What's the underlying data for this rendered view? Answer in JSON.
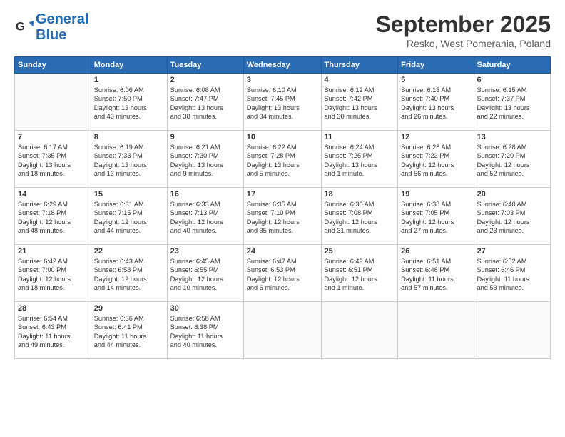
{
  "header": {
    "logo_line1": "General",
    "logo_line2": "Blue",
    "month": "September 2025",
    "location": "Resko, West Pomerania, Poland"
  },
  "weekdays": [
    "Sunday",
    "Monday",
    "Tuesday",
    "Wednesday",
    "Thursday",
    "Friday",
    "Saturday"
  ],
  "weeks": [
    [
      {
        "day": "",
        "info": ""
      },
      {
        "day": "1",
        "info": "Sunrise: 6:06 AM\nSunset: 7:50 PM\nDaylight: 13 hours\nand 43 minutes."
      },
      {
        "day": "2",
        "info": "Sunrise: 6:08 AM\nSunset: 7:47 PM\nDaylight: 13 hours\nand 38 minutes."
      },
      {
        "day": "3",
        "info": "Sunrise: 6:10 AM\nSunset: 7:45 PM\nDaylight: 13 hours\nand 34 minutes."
      },
      {
        "day": "4",
        "info": "Sunrise: 6:12 AM\nSunset: 7:42 PM\nDaylight: 13 hours\nand 30 minutes."
      },
      {
        "day": "5",
        "info": "Sunrise: 6:13 AM\nSunset: 7:40 PM\nDaylight: 13 hours\nand 26 minutes."
      },
      {
        "day": "6",
        "info": "Sunrise: 6:15 AM\nSunset: 7:37 PM\nDaylight: 13 hours\nand 22 minutes."
      }
    ],
    [
      {
        "day": "7",
        "info": "Sunrise: 6:17 AM\nSunset: 7:35 PM\nDaylight: 13 hours\nand 18 minutes."
      },
      {
        "day": "8",
        "info": "Sunrise: 6:19 AM\nSunset: 7:33 PM\nDaylight: 13 hours\nand 13 minutes."
      },
      {
        "day": "9",
        "info": "Sunrise: 6:21 AM\nSunset: 7:30 PM\nDaylight: 13 hours\nand 9 minutes."
      },
      {
        "day": "10",
        "info": "Sunrise: 6:22 AM\nSunset: 7:28 PM\nDaylight: 13 hours\nand 5 minutes."
      },
      {
        "day": "11",
        "info": "Sunrise: 6:24 AM\nSunset: 7:25 PM\nDaylight: 13 hours\nand 1 minute."
      },
      {
        "day": "12",
        "info": "Sunrise: 6:26 AM\nSunset: 7:23 PM\nDaylight: 12 hours\nand 56 minutes."
      },
      {
        "day": "13",
        "info": "Sunrise: 6:28 AM\nSunset: 7:20 PM\nDaylight: 12 hours\nand 52 minutes."
      }
    ],
    [
      {
        "day": "14",
        "info": "Sunrise: 6:29 AM\nSunset: 7:18 PM\nDaylight: 12 hours\nand 48 minutes."
      },
      {
        "day": "15",
        "info": "Sunrise: 6:31 AM\nSunset: 7:15 PM\nDaylight: 12 hours\nand 44 minutes."
      },
      {
        "day": "16",
        "info": "Sunrise: 6:33 AM\nSunset: 7:13 PM\nDaylight: 12 hours\nand 40 minutes."
      },
      {
        "day": "17",
        "info": "Sunrise: 6:35 AM\nSunset: 7:10 PM\nDaylight: 12 hours\nand 35 minutes."
      },
      {
        "day": "18",
        "info": "Sunrise: 6:36 AM\nSunset: 7:08 PM\nDaylight: 12 hours\nand 31 minutes."
      },
      {
        "day": "19",
        "info": "Sunrise: 6:38 AM\nSunset: 7:05 PM\nDaylight: 12 hours\nand 27 minutes."
      },
      {
        "day": "20",
        "info": "Sunrise: 6:40 AM\nSunset: 7:03 PM\nDaylight: 12 hours\nand 23 minutes."
      }
    ],
    [
      {
        "day": "21",
        "info": "Sunrise: 6:42 AM\nSunset: 7:00 PM\nDaylight: 12 hours\nand 18 minutes."
      },
      {
        "day": "22",
        "info": "Sunrise: 6:43 AM\nSunset: 6:58 PM\nDaylight: 12 hours\nand 14 minutes."
      },
      {
        "day": "23",
        "info": "Sunrise: 6:45 AM\nSunset: 6:55 PM\nDaylight: 12 hours\nand 10 minutes."
      },
      {
        "day": "24",
        "info": "Sunrise: 6:47 AM\nSunset: 6:53 PM\nDaylight: 12 hours\nand 6 minutes."
      },
      {
        "day": "25",
        "info": "Sunrise: 6:49 AM\nSunset: 6:51 PM\nDaylight: 12 hours\nand 1 minute."
      },
      {
        "day": "26",
        "info": "Sunrise: 6:51 AM\nSunset: 6:48 PM\nDaylight: 11 hours\nand 57 minutes."
      },
      {
        "day": "27",
        "info": "Sunrise: 6:52 AM\nSunset: 6:46 PM\nDaylight: 11 hours\nand 53 minutes."
      }
    ],
    [
      {
        "day": "28",
        "info": "Sunrise: 6:54 AM\nSunset: 6:43 PM\nDaylight: 11 hours\nand 49 minutes."
      },
      {
        "day": "29",
        "info": "Sunrise: 6:56 AM\nSunset: 6:41 PM\nDaylight: 11 hours\nand 44 minutes."
      },
      {
        "day": "30",
        "info": "Sunrise: 6:58 AM\nSunset: 6:38 PM\nDaylight: 11 hours\nand 40 minutes."
      },
      {
        "day": "",
        "info": ""
      },
      {
        "day": "",
        "info": ""
      },
      {
        "day": "",
        "info": ""
      },
      {
        "day": "",
        "info": ""
      }
    ]
  ]
}
